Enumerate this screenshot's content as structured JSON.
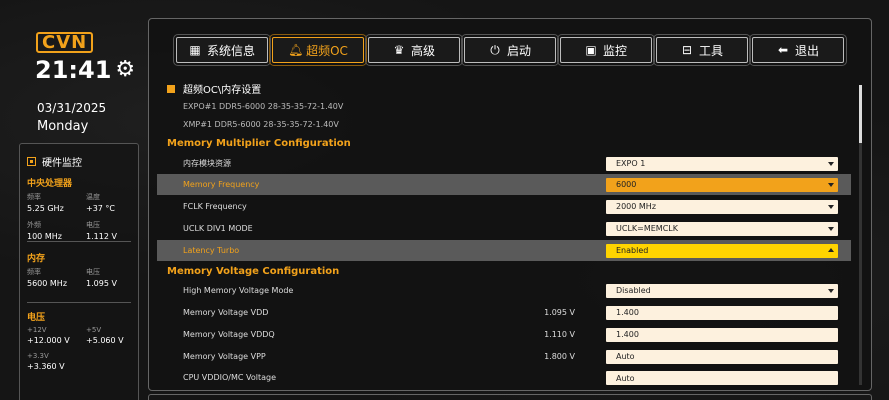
{
  "app": {
    "logo": "CVN",
    "time": "21:41",
    "date": "03/31/2025",
    "weekday": "Monday",
    "accent_color": "#f2a21b"
  },
  "hardware": {
    "title": "硬件监控",
    "cpu": {
      "head": "中央处理器",
      "freq_label": "频率",
      "temp_label": "温度",
      "freq": "5.25 GHz",
      "temp": "+37 °C",
      "ext_label": "外频",
      "volt_label": "电压",
      "ext": "100 MHz",
      "volt": "1.112 V"
    },
    "memory": {
      "head": "内存",
      "freq_label": "频率",
      "volt_label": "电压",
      "freq": "5600 MHz",
      "volt": "1.095 V"
    },
    "voltage": {
      "head": "电压",
      "v12_label": "+12V",
      "v5_label": "+5V",
      "v12": "+12.000 V",
      "v5": "+5.060 V",
      "v33_label": "+3.3V",
      "v33": "+3.360 V"
    }
  },
  "tabs": [
    {
      "label": "系统信息",
      "icon": "grid-icon"
    },
    {
      "label": "超频OC",
      "icon": "bell-icon"
    },
    {
      "label": "高级",
      "icon": "crown-icon"
    },
    {
      "label": "启动",
      "icon": "power-icon"
    },
    {
      "label": "监控",
      "icon": "monitor-icon"
    },
    {
      "label": "工具",
      "icon": "toolbox-icon"
    },
    {
      "label": "退出",
      "icon": "back-arrow-icon"
    }
  ],
  "content": {
    "heading": "超频OC\\内存设置",
    "expo_info": "EXPO#1 DDR5-6000 28-35-35-72-1.40V",
    "xmp_info": "XMP#1  DDR5-6000 28-35-35-72-1.40V",
    "section_multiplier": "Memory Multiplier Configuration",
    "section_voltage": "Memory Voltage Configuration",
    "rows": [
      {
        "label": "内存模块资源",
        "value": "EXPO 1",
        "type": "select"
      },
      {
        "label": "Memory Frequency",
        "value": "6000",
        "type": "select"
      },
      {
        "label": "FCLK Frequency",
        "value": "2000 MHz",
        "type": "select"
      },
      {
        "label": "UCLK DIV1 MODE",
        "value": "UCLK=MEMCLK",
        "type": "select"
      },
      {
        "label": "Latency Turbo",
        "value": "Enabled",
        "type": "select-open"
      },
      {
        "label": "High Memory Voltage Mode",
        "value": "Disabled",
        "type": "select"
      },
      {
        "label": "Memory Voltage VDD",
        "current": "1.095 V",
        "value": "1.400",
        "type": "input"
      },
      {
        "label": "Memory Voltage VDDQ",
        "current": "1.110 V",
        "value": "1.400",
        "type": "input"
      },
      {
        "label": "Memory Voltage VPP",
        "current": "1.800 V",
        "value": "Auto",
        "type": "input"
      },
      {
        "label": "CPU VDDIO/MC Voltage",
        "value": "Auto",
        "type": "input"
      }
    ]
  }
}
